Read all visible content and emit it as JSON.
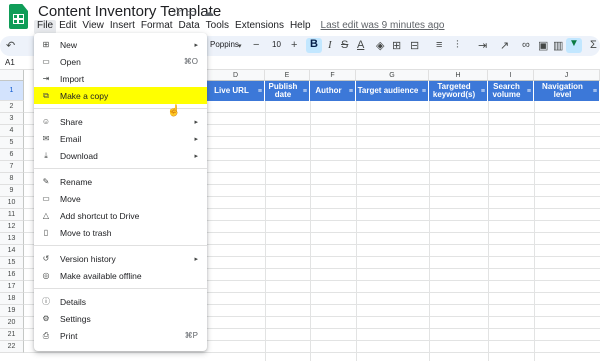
{
  "window": {
    "title": "Content Inventory Template",
    "last_edit": "Last edit was 9 minutes ago"
  },
  "menubar": [
    "File",
    "Edit",
    "View",
    "Insert",
    "Format",
    "Data",
    "Tools",
    "Extensions",
    "Help"
  ],
  "toolbar": {
    "font": "Poppins",
    "font_size": "10",
    "bold": "B",
    "italic": "I",
    "strike": "S",
    "text_color": "A"
  },
  "formula_bar": {
    "cell_ref": "A1"
  },
  "columns": [
    "D",
    "E",
    "F",
    "G",
    "H",
    "I",
    "J"
  ],
  "header_cells": [
    "Live URL",
    "Publish date",
    "Author",
    "Target audience",
    "Targeted keyword(s)",
    "Search volume",
    "Navigation level"
  ],
  "row_numbers": [
    "1",
    "2",
    "3",
    "4",
    "5",
    "6",
    "7",
    "8",
    "9",
    "10",
    "11",
    "12",
    "13",
    "14",
    "15",
    "16",
    "17",
    "18",
    "19",
    "20",
    "21",
    "22"
  ],
  "file_menu": {
    "items": [
      {
        "label": "New",
        "icon": "plus-box-icon",
        "submenu": true
      },
      {
        "label": "Open",
        "icon": "folder-icon",
        "shortcut": "⌘O"
      },
      {
        "label": "Import",
        "icon": "import-icon"
      },
      {
        "label": "Make a copy",
        "icon": "copy-icon",
        "highlight": true
      },
      {
        "label": "Share",
        "icon": "person-add-icon",
        "submenu": true
      },
      {
        "label": "Email",
        "icon": "email-icon",
        "submenu": true
      },
      {
        "label": "Download",
        "icon": "download-icon",
        "submenu": true
      },
      {
        "label": "Rename",
        "icon": "rename-icon"
      },
      {
        "label": "Move",
        "icon": "move-folder-icon"
      },
      {
        "label": "Add shortcut to Drive",
        "icon": "drive-shortcut-icon"
      },
      {
        "label": "Move to trash",
        "icon": "trash-icon"
      },
      {
        "label": "Version history",
        "icon": "history-icon",
        "submenu": true
      },
      {
        "label": "Make available offline",
        "icon": "offline-icon"
      },
      {
        "label": "Details",
        "icon": "info-icon"
      },
      {
        "label": "Settings",
        "icon": "settings-icon"
      },
      {
        "label": "Print",
        "icon": "print-icon",
        "shortcut": "⌘P"
      }
    ]
  },
  "colors": {
    "header_blue": "#3c78d8",
    "highlight": "#ffff00",
    "brand_green": "#0f9d58"
  }
}
